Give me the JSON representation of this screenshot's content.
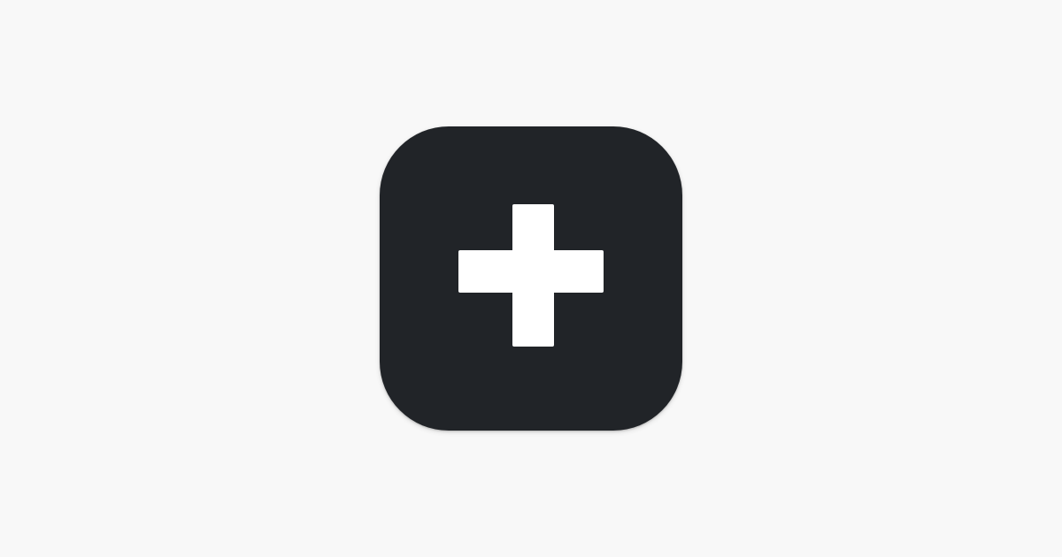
{
  "app_icon": {
    "icon": "plus-icon",
    "background_color": "#212428",
    "glyph_color": "#ffffff"
  },
  "page": {
    "background_color": "#f8f8f8"
  }
}
